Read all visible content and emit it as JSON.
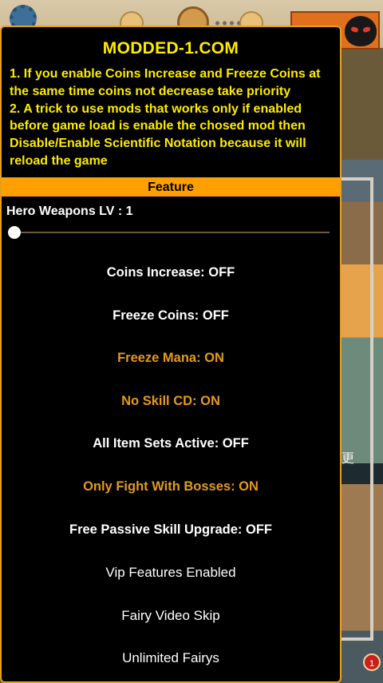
{
  "background": {
    "right_glyph": "更",
    "badge_count": "1"
  },
  "menu": {
    "title": "MODDED-1.COM",
    "notes": [
      "1. If you enable Coins Increase and Freeze Coins at the same time coins not decrease take priority",
      "2. A trick to use mods that works only if enabled before game load is enable the chosed mod then Disable/Enable Scientific Notation because it will reload the game"
    ],
    "section_title": "Feature",
    "slider": {
      "label": "Hero Weapons LV : 1",
      "value": 1
    },
    "toggles": [
      {
        "label": "Coins Increase: OFF",
        "state": "off"
      },
      {
        "label": "Freeze Coins: OFF",
        "state": "off"
      },
      {
        "label": "Freeze Mana: ON",
        "state": "on"
      },
      {
        "label": "No Skill CD: ON",
        "state": "on"
      },
      {
        "label": "All Item Sets Active: OFF",
        "state": "off"
      },
      {
        "label": "Only Fight With Bosses: ON",
        "state": "on"
      },
      {
        "label": "Free Passive Skill Upgrade: OFF",
        "state": "off"
      }
    ],
    "buttons": [
      {
        "label": "Vip Features Enabled"
      },
      {
        "label": "Fairy Video Skip"
      },
      {
        "label": "Unlimited Fairys"
      }
    ]
  },
  "colors": {
    "accent_yellow": "#ffeb00",
    "header_orange": "#ffa000",
    "on_color": "#e59a1d",
    "off_color": "#ffffff"
  }
}
